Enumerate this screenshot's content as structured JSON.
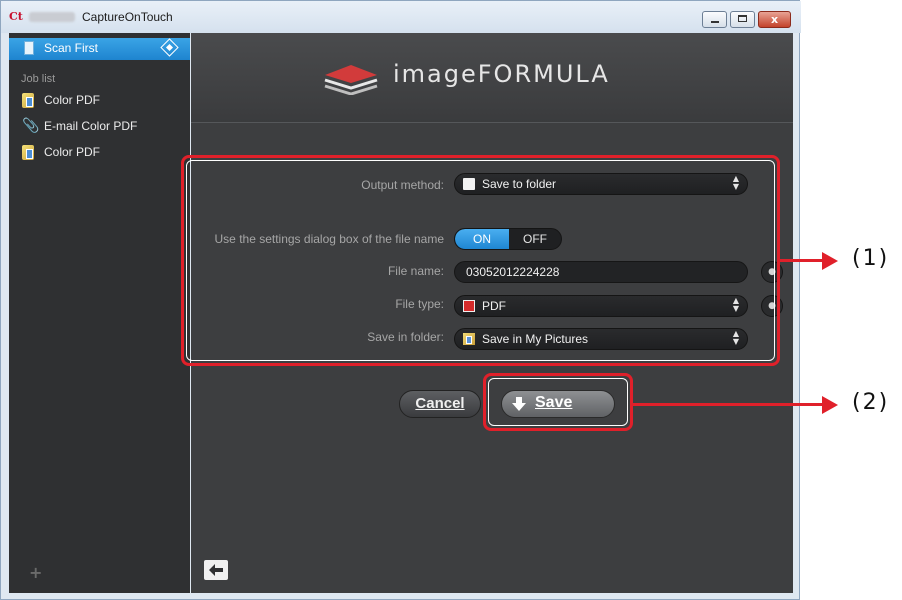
{
  "window": {
    "app_logo": "Ct",
    "title": "CaptureOnTouch",
    "minimize_label": "",
    "maximize_label": "",
    "close_label": "x"
  },
  "sidebar": {
    "selected_label": "Scan First",
    "job_list_title": "Job list",
    "jobs": [
      {
        "label": "Color PDF",
        "icon": "folder-pictures-icon"
      },
      {
        "label": "E-mail Color PDF",
        "icon": "paperclip-icon"
      },
      {
        "label": "Color PDF",
        "icon": "folder-pictures-icon"
      }
    ],
    "add_label": "+"
  },
  "header": {
    "brand": "imageFORMULA"
  },
  "form": {
    "output_method_label": "Output method:",
    "output_method_value": "Save to folder",
    "dialog_label": "Use the settings dialog box of the file name",
    "toggle_on": "ON",
    "toggle_off": "OFF",
    "file_name_label": "File name:",
    "file_name_value": "03052012224228",
    "file_type_label": "File type:",
    "file_type_value": "PDF",
    "save_folder_label": "Save in folder:",
    "save_folder_value": "Save in My Pictures"
  },
  "actions": {
    "cancel_label": "Cancel",
    "save_label": "Save"
  },
  "callouts": {
    "one": "(1)",
    "two": "(2)"
  },
  "colors": {
    "accent_blue": "#1e84cf",
    "callout_red": "#e0202a",
    "panel_dark": "#3d3e40",
    "sidebar_dark": "#2f3032"
  }
}
